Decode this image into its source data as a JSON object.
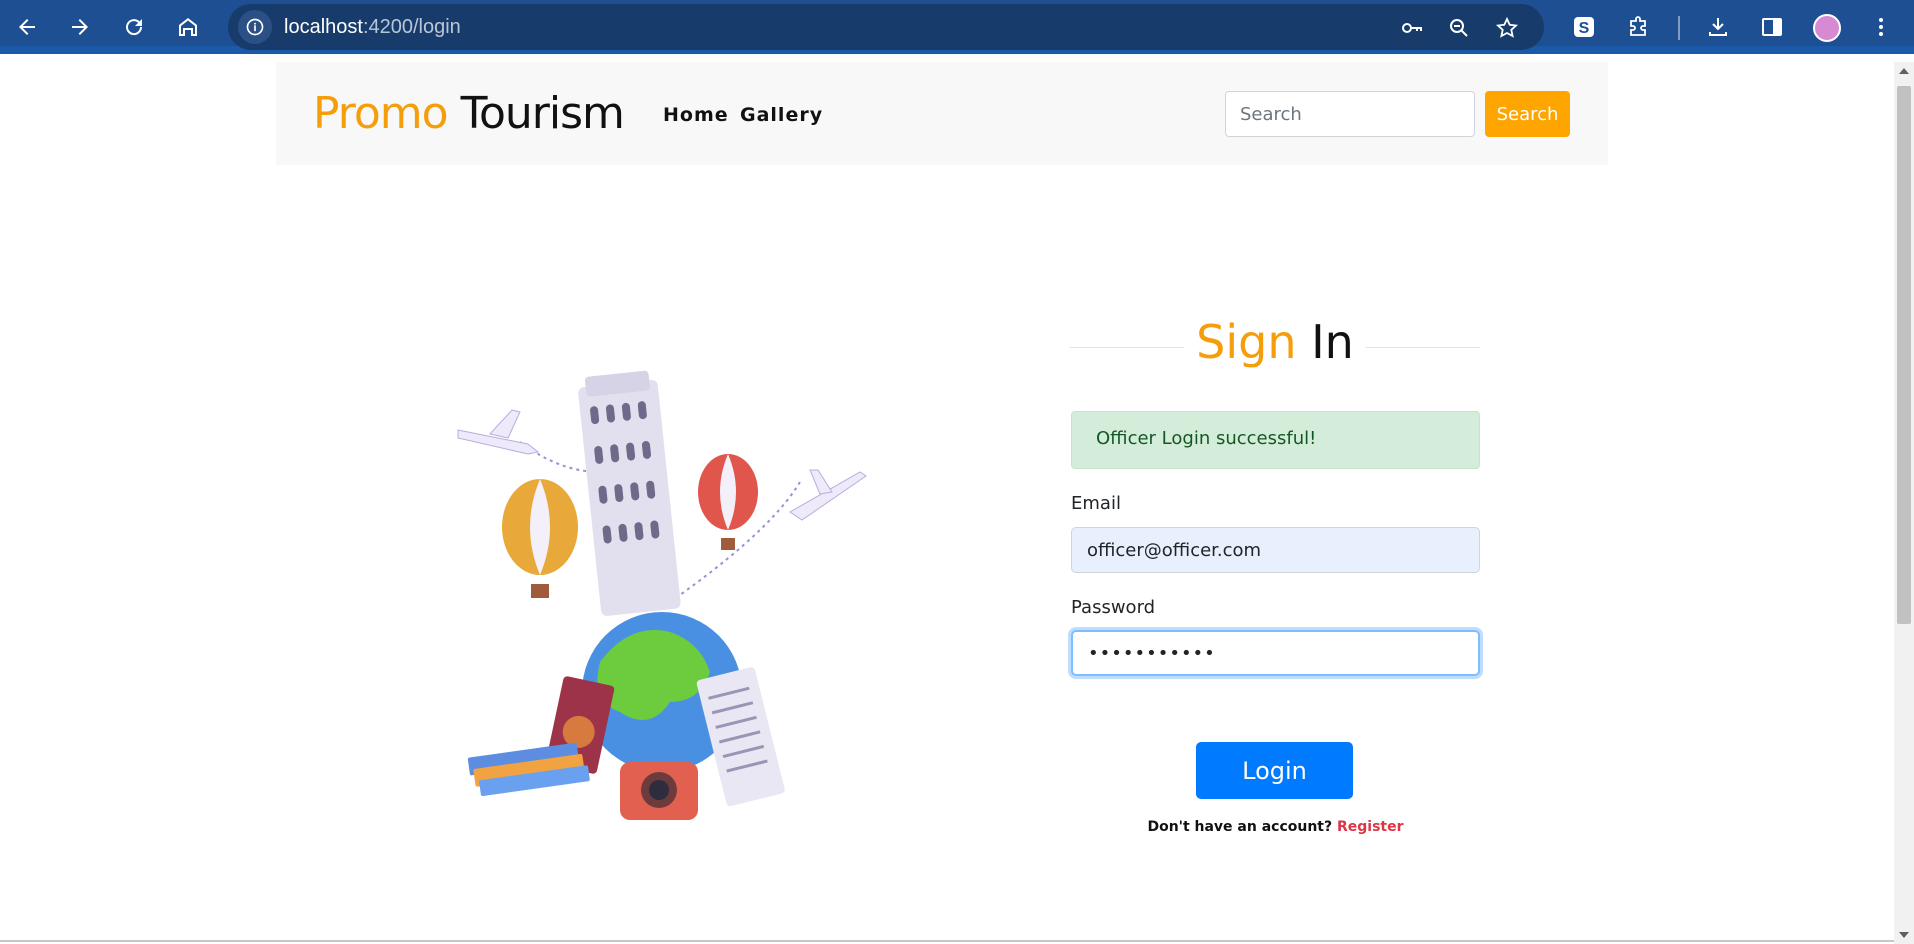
{
  "browser": {
    "url_host": "localhost",
    "url_path": ":4200/login",
    "icons": {
      "back": "back-arrow-icon",
      "forward": "forward-arrow-icon",
      "reload": "reload-icon",
      "home": "home-icon",
      "site_info": "info-icon",
      "password_key": "key-icon",
      "zoom": "zoom-out-icon",
      "bookmark": "star-icon",
      "extension_s": "s-extension-icon",
      "extensions": "puzzle-icon",
      "downloads": "download-icon",
      "side_panel": "side-panel-icon",
      "profile": "avatar",
      "menu": "kebab-menu-icon"
    }
  },
  "navbar": {
    "brand_part1": "Promo",
    "brand_part2": "Tourism",
    "links": [
      "Home",
      "Gallery"
    ],
    "search_placeholder": "Search",
    "search_button": "Search"
  },
  "form": {
    "title_part1": "Sign",
    "title_part2": "In",
    "alert": "Officer Login successful!",
    "email_label": "Email",
    "email_value": "officer@officer.com",
    "password_label": "Password",
    "password_value": "•••••••••••",
    "login_button": "Login",
    "register_prompt": "Don't have an account?",
    "register_link": "Register"
  },
  "colors": {
    "accent_orange": "#f59e0b",
    "search_button": "#ffa500",
    "login_button": "#007bff",
    "register_link": "#dc3545",
    "alert_bg": "#d4edda",
    "chrome_bar": "#1e4f92"
  }
}
